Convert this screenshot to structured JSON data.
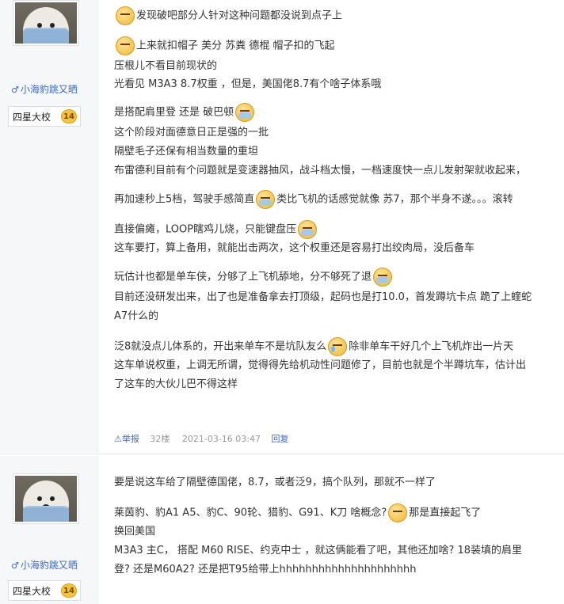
{
  "posts": [
    {
      "username": "小海豹跳又晒",
      "gender_icon": "♂",
      "rank": "四星大校",
      "rank_level": "14",
      "lines": [
        {
          "segments": [
            "",
            "发现破吧部分人针对这种问题都没说到点子上"
          ]
        },
        {
          "segments": [
            "",
            "上来就扣帽子 美分 苏粪 德棍 帽子扣的飞起"
          ]
        },
        {
          "segments": [
            "压根儿不看目前现状的"
          ]
        },
        {
          "segments": [
            "光看见 M3A3 8.7权重 ，但是，美国佬8.7有个啥子体系哦"
          ]
        },
        {
          "segments": [
            "是搭配肩里登 还是 破巴顿",
            ""
          ]
        },
        {
          "segments": [
            "这个阶段对面德意日正是强的一批"
          ]
        },
        {
          "segments": [
            "隔壁毛子还保有相当数量的重坦"
          ]
        },
        {
          "segments": [
            "布雷德利目前有个问题就是变速器抽风，战斗档太慢，一档速度快一点儿发射架就收起来，"
          ]
        },
        {
          "segments": [
            "再加速秒上5档，驾驶手感简直",
            "类比飞机的话感觉就像 苏7，那个半身不遂。。。滚转"
          ]
        },
        {
          "segments": [
            "直接偏瘫，LOOP瞎鸡儿烧，只能键盘压",
            ""
          ]
        },
        {
          "segments": [
            "这车要打，算上备用，就能出击两次，这个权重还是容易打出绞肉局，没后备车"
          ]
        },
        {
          "segments": [
            "玩估计也都是单车侠，分够了上飞机舔地，分不够死了退",
            ""
          ]
        },
        {
          "segments": [
            "目前还没研发出来，出了也是准备拿去打顶级，起码也是打10.0，首发蹲坑卡点 跪了上蝰蛇"
          ]
        },
        {
          "segments": [
            "A7什么的"
          ]
        },
        {
          "segments": [
            "泛8就没点儿体系的，开出来单车不是坑队友么",
            "除非单车干好几个上飞机炸出一片天"
          ]
        },
        {
          "segments": [
            "这车单说权重，上调无所谓，觉得得先给机动性问题修了，目前也就是个半蹲坑车，估计出"
          ]
        },
        {
          "segments": [
            "了这车的大伙儿巴不得这样"
          ]
        }
      ],
      "meta": {
        "report": "举报",
        "floor": "32楼",
        "time": "2021-03-16 03:47",
        "reply": "回复"
      }
    },
    {
      "username": "小海豹跳又晒",
      "gender_icon": "♂",
      "rank": "四星大校",
      "rank_level": "14",
      "lines": [
        {
          "segments": [
            "要是说这车给了隔壁德国佬，8.7，或者泛9，搞个队列，那就不一样了"
          ]
        },
        {
          "segments": [
            "莱茵豹、豹A1 A5、豹C、90轮、猎豹、G91、K刀 啥概念?",
            "那是直接起飞了"
          ]
        },
        {
          "segments": [
            "换回美国"
          ]
        },
        {
          "segments": [
            "M3A3 主C， 搭配 M60 RISE、约克中士 ，就这俩能看了吧，其他还加啥? 18装填的肩里"
          ]
        },
        {
          "segments": [
            "登? 还是M60A2? 还是把T95给带上hhhhhhhhhhhhhhhhhhhhh"
          ]
        }
      ]
    }
  ]
}
